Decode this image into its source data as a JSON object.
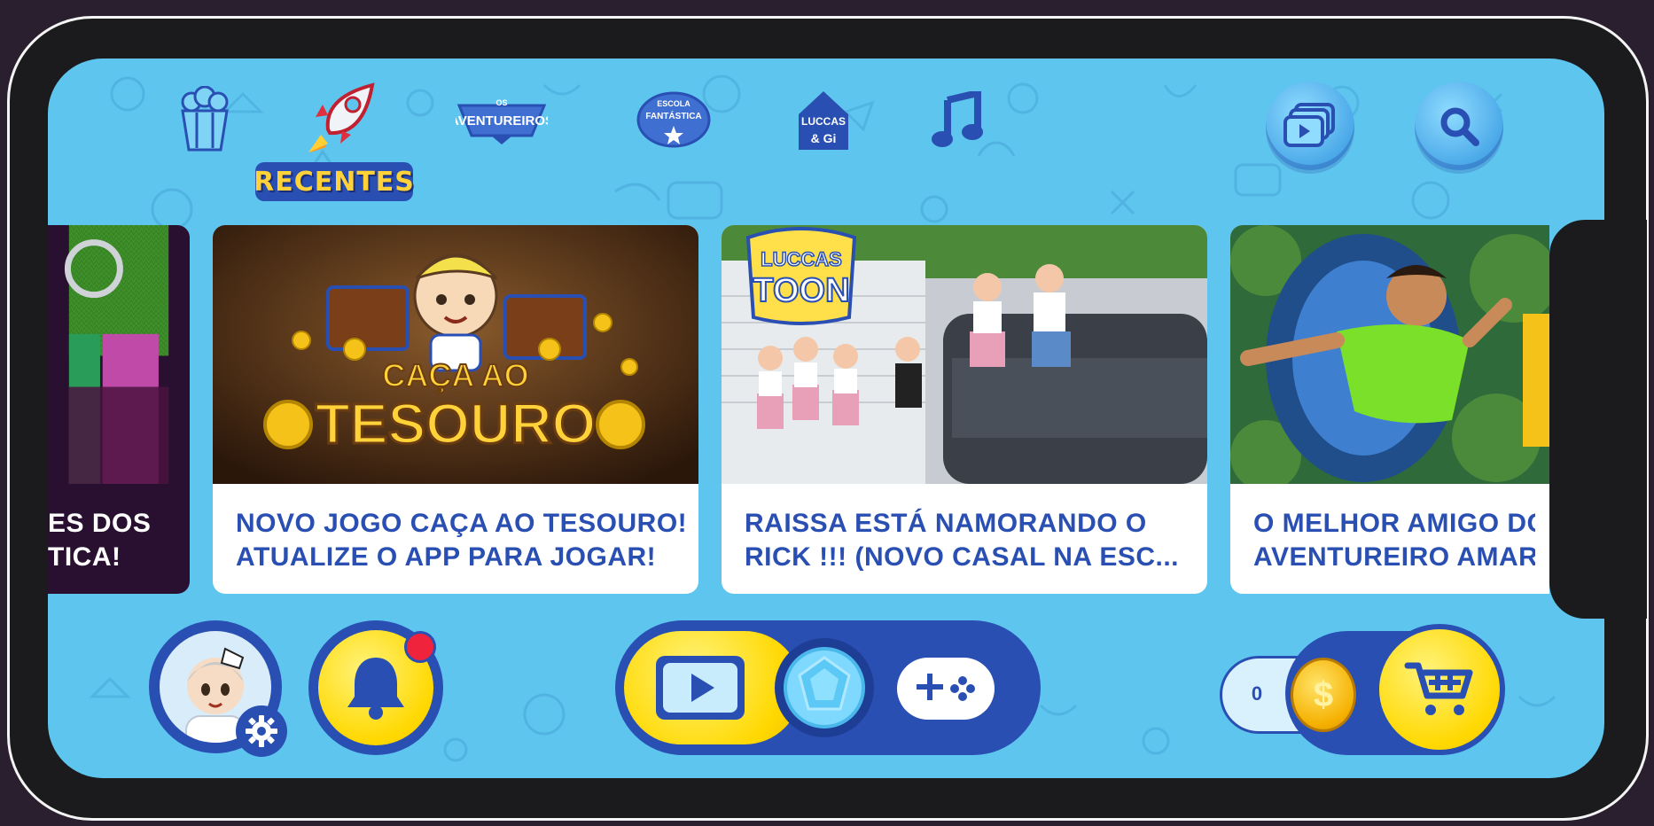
{
  "nav": {
    "items": [
      {
        "name": "popcorn",
        "label": ""
      },
      {
        "name": "recentes",
        "label": "RECENTES"
      },
      {
        "name": "os-aventureiros",
        "label": "OS AVENTUREIROS"
      },
      {
        "name": "escola-fantastica",
        "label": "ESCOLA FANTÁSTICA"
      },
      {
        "name": "luccas-gi",
        "label": "LUCCAS & GI"
      },
      {
        "name": "music",
        "label": ""
      }
    ],
    "active_label": "RECENTES"
  },
  "header_buttons": {
    "videos": "videos-icon",
    "search": "search-icon"
  },
  "cards": [
    {
      "title_lines": [
        "ES DOS",
        "TICA!"
      ]
    },
    {
      "title_lines": [
        "NOVO JOGO CAÇA AO TESOURO!",
        "ATUALIZE O APP PARA JOGAR!"
      ],
      "thumb_text": [
        "CAÇA AO",
        "TESOURO"
      ]
    },
    {
      "title_lines": [
        "RAISSA ESTÁ NAMORANDO O",
        "RICK !!! (NOVO CASAL NA ESC..."
      ],
      "thumb_text": [
        "LUCCAS",
        "TOON"
      ]
    },
    {
      "title_lines": [
        "O MELHOR AMIGO DO",
        "AVENTUREIRO AMARE"
      ]
    }
  ],
  "bottom": {
    "coins": "0",
    "coin_symbol": "$",
    "notifications_dot": true
  },
  "colors": {
    "background": "#5ec6ee",
    "accent_blue": "#2a4fb3",
    "yellow": "#ffd800",
    "badge_red": "#f0233c"
  }
}
